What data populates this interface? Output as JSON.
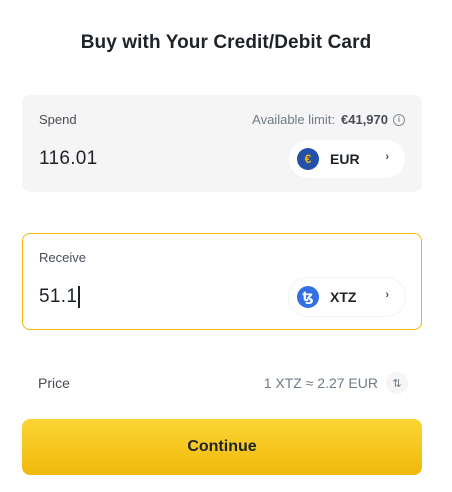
{
  "title": "Buy with Your Credit/Debit Card",
  "spend": {
    "label": "Spend",
    "limit_label": "Available limit:",
    "limit_value": "€41,970",
    "amount": "116.01",
    "currency": "EUR",
    "currency_icon": "euro-coin-icon",
    "currency_icon_glyph": "€"
  },
  "receive": {
    "label": "Receive",
    "amount": "51.1",
    "currency": "XTZ",
    "currency_icon": "tezos-coin-icon",
    "currency_icon_glyph": "ꜩ"
  },
  "price": {
    "label": "Price",
    "value": "1 XTZ ≈ 2.27 EUR"
  },
  "continue_label": "Continue",
  "colors": {
    "accent": "#f0b90b",
    "button_top": "#fcd535",
    "text_primary": "#1e2329",
    "panel_bg": "#f5f5f5"
  }
}
